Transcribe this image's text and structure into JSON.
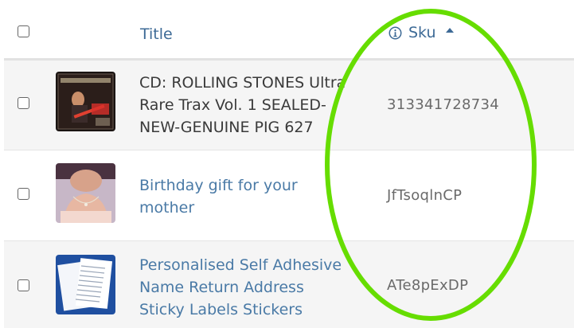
{
  "header": {
    "title_label": "Title",
    "sku_label": "Sku",
    "sort_direction": "ascending"
  },
  "rows": [
    {
      "title": "CD: ROLLING STONES Ultra\nRare Trax Vol. 1 SEALED-\nNEW-GENUINE PIG 627",
      "title_style": "plain",
      "sku": "313341728734",
      "thumbnail": "cd-cover-guitarist-image"
    },
    {
      "title": "Birthday gift for your\nmother",
      "title_style": "link",
      "sku": "JfTsoqlnCP",
      "thumbnail": "necklace-model-image"
    },
    {
      "title": "Personalised Self Adhesive\nName Return Address\nSticky Labels Stickers",
      "title_style": "link",
      "sku": "ATe8pExDP",
      "thumbnail": "label-sheets-image"
    }
  ],
  "colors": {
    "header_text": "#3d6a96",
    "link_text": "#4a7aa6",
    "annotation_circle": "#66dd00"
  }
}
